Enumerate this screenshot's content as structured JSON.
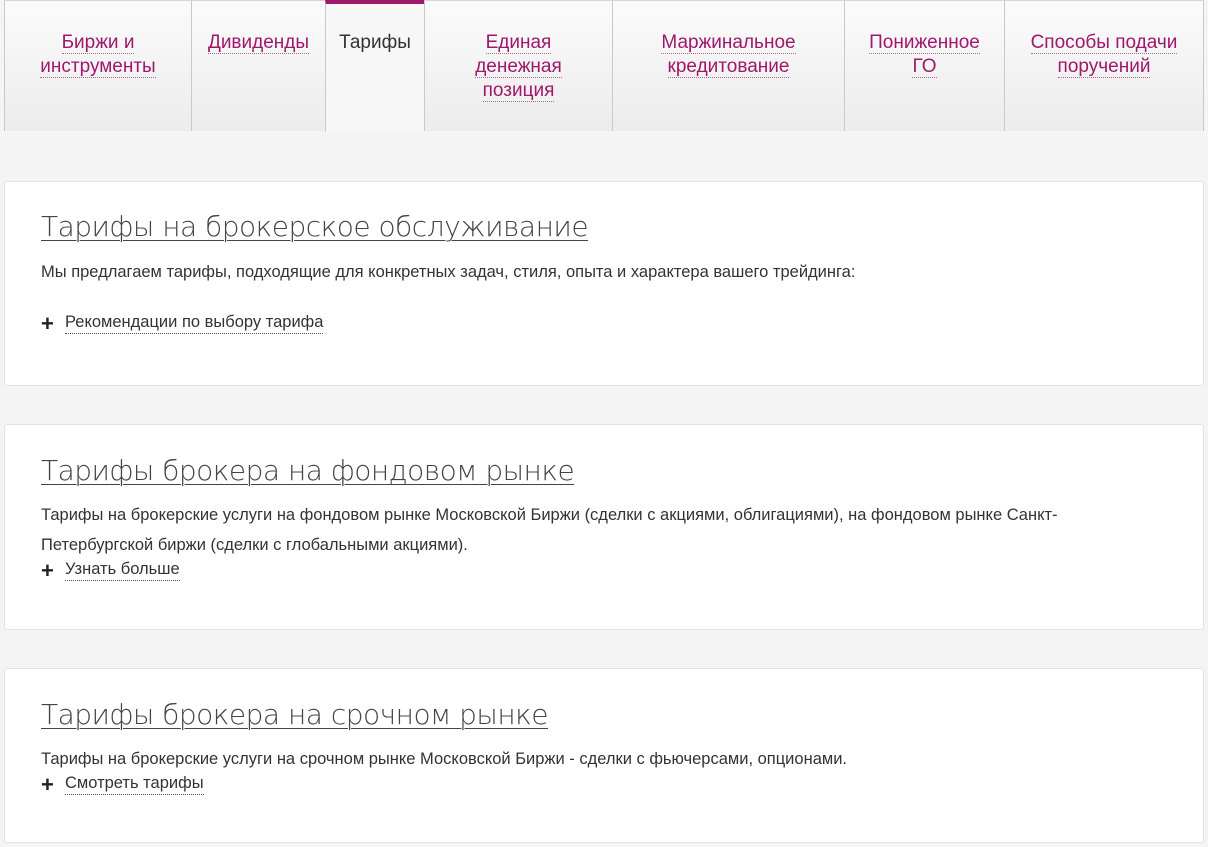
{
  "tabs": [
    {
      "line1": "Биржи и",
      "line2": "инструменты",
      "line3": ""
    },
    {
      "line1": "Дивиденды",
      "line2": "",
      "line3": ""
    },
    {
      "line1": "Тарифы",
      "line2": "",
      "line3": ""
    },
    {
      "line1": "Единая",
      "line2": "денежная",
      "line3": "позиция"
    },
    {
      "line1": "Маржинальное",
      "line2": "кредитование",
      "line3": ""
    },
    {
      "line1": "Пониженное",
      "line2": "ГО",
      "line3": ""
    },
    {
      "line1": "Способы подачи",
      "line2": "поручений",
      "line3": ""
    }
  ],
  "active_tab": "Тарифы",
  "colors": {
    "accent": "#a0186c",
    "background": "#f4f4f4",
    "card": "#ffffff"
  },
  "cards": [
    {
      "title": "Тарифы на брокерское обслуживание",
      "text": "Мы предлагаем тарифы, подходящие для конкретных задач, стиля, опыта и характера вашего трейдинга:",
      "link": "Рекомендации по выбору тарифа"
    },
    {
      "title": "Тарифы брокера на фондовом рынке",
      "text": "Тарифы на брокерские услуги на фондовом рынке Московской Биржи (сделки с акциями, облигациями), на фондовом рынке Санкт-Петербургской биржи (сделки с глобальными акциями).",
      "link": "Узнать больше"
    },
    {
      "title": "Тарифы брокера на срочном рынке",
      "text": "Тарифы на брокерские услуги на срочном рынке Московской Биржи - сделки с фьючерсами, опционами.",
      "link": "Смотреть тарифы"
    }
  ]
}
